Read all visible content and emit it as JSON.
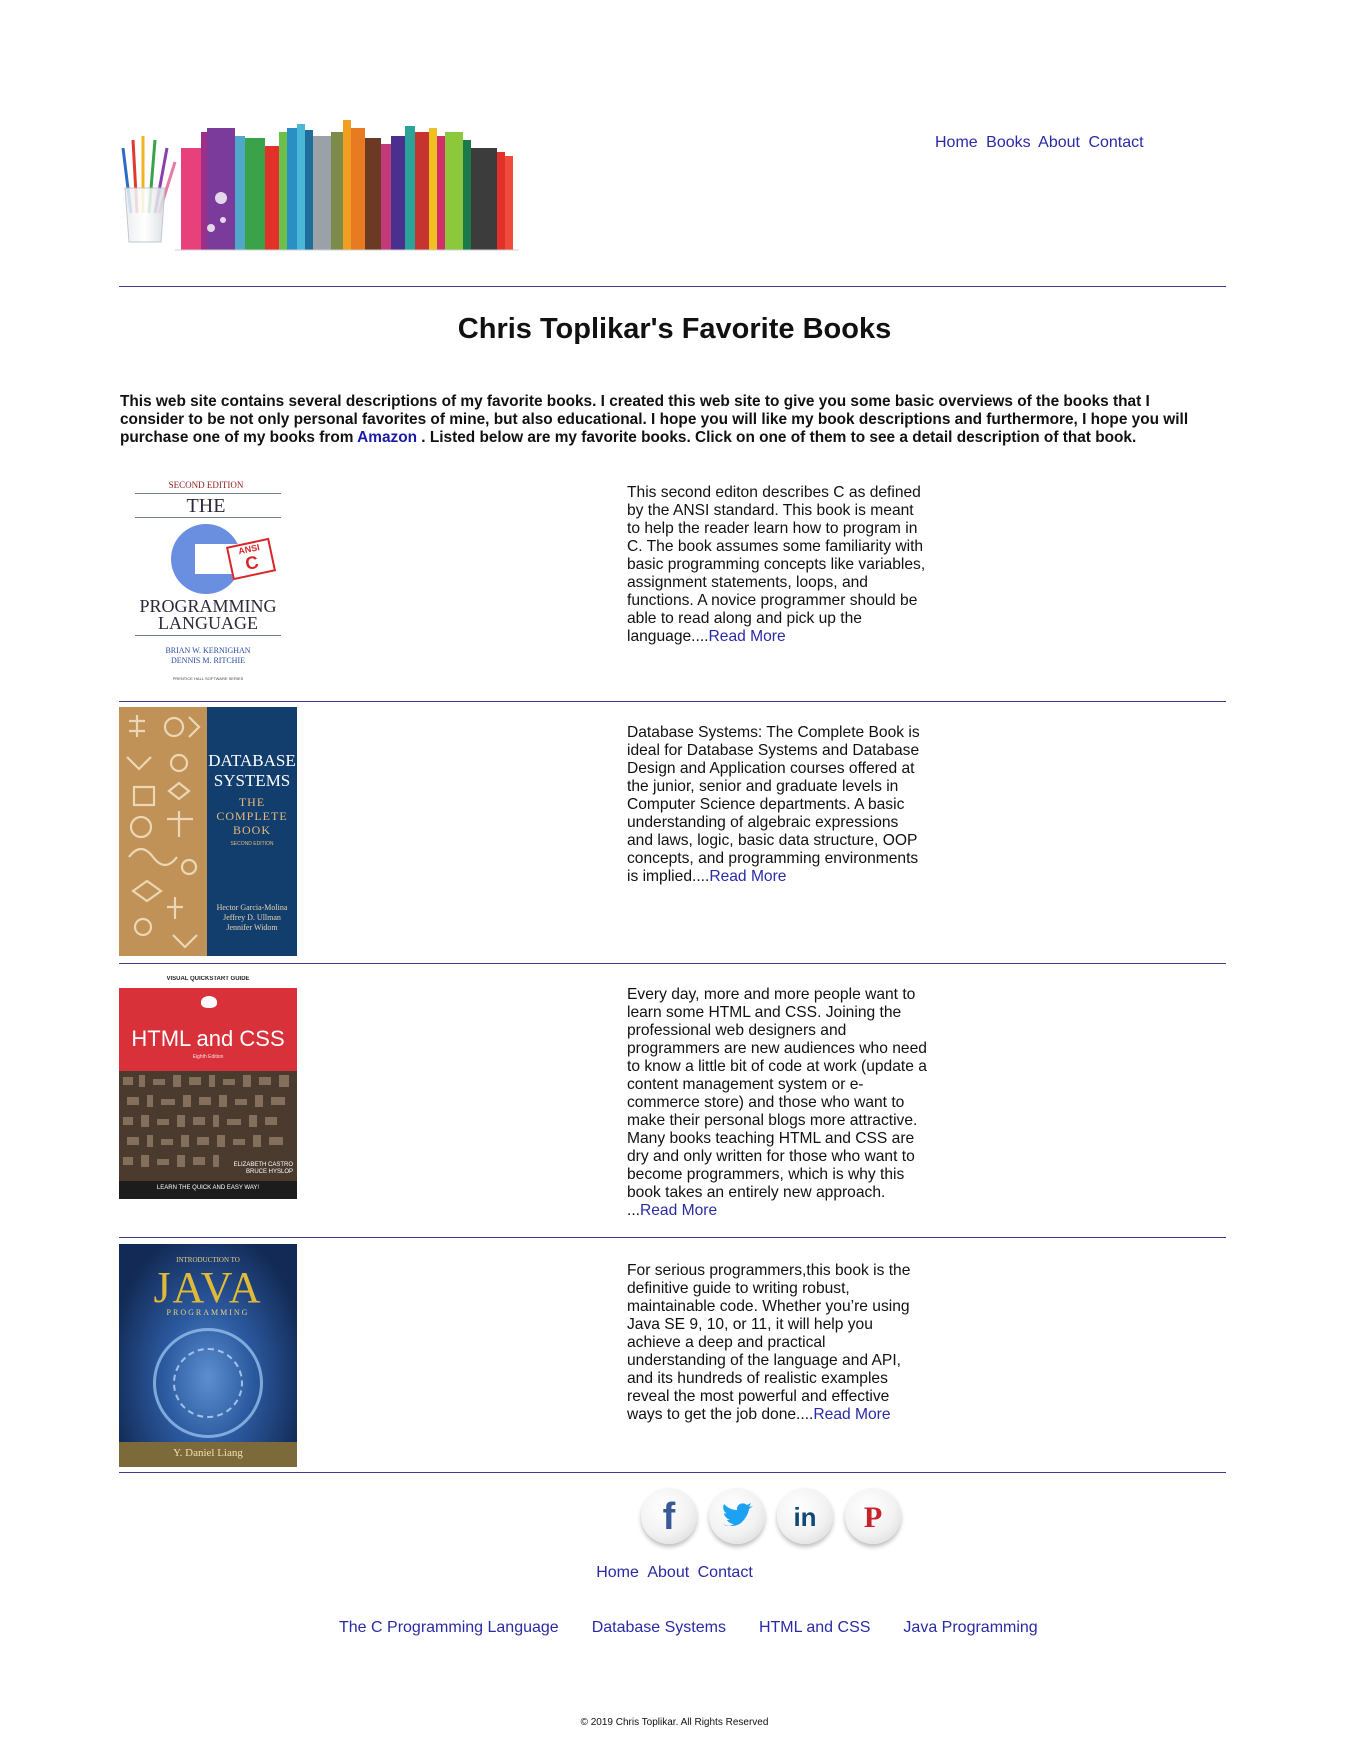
{
  "header": {
    "nav": [
      {
        "label": "Home"
      },
      {
        "label": "Books"
      },
      {
        "label": "About"
      },
      {
        "label": "Contact"
      }
    ]
  },
  "main": {
    "title": "Chris Toplikar's Favorite Books",
    "intro_before": "This web site contains several descriptions of my favorite books. I created this web site to give you some basic overviews of the books that I consider to be not only personal favorites of mine, but also educational. I hope you will like my book descriptions and furthermore, I hope you will purchase one of my books from ",
    "intro_link": "Amazon",
    "intro_after": " . Listed below are my favorite books. Click on one of them to see a detail description of that book.",
    "books": [
      {
        "cover": {
          "edition": "SECOND EDITION",
          "the": "THE",
          "badge_top": "ANSI",
          "badge_letter": "C",
          "line1": "PROGRAMMING",
          "line2": "LANGUAGE",
          "author1": "BRIAN W. KERNIGHAN",
          "author2": "DENNIS M. RITCHIE",
          "series": "PRENTICE HALL SOFTWARE SERIES"
        },
        "text": "This second editon describes C as defined by the ANSI standard. This book is meant to help the reader learn how to program in C. The book assumes some familiarity with basic programming concepts like variables, assignment statements, loops, and functions. A novice programmer should be able to read along and pick up the language....",
        "link": "Read More"
      },
      {
        "cover": {
          "title1": "DATABASE",
          "title2": "SYSTEMS",
          "sub1": "THE",
          "sub2": "COMPLETE",
          "sub3": "BOOK",
          "edition": "SECOND EDITION",
          "author1": "Hector Garcia-Molina",
          "author2": "Jeffrey D. Ullman",
          "author3": "Jennifer Widom"
        },
        "text": "Database Systems: The Complete Book is ideal for Database Systems and Database Design and Application courses offered at the junior, senior and graduate levels in Computer Science departments. A basic understanding of algebraic expressions and laws, logic, basic data structure, OOP concepts, and programming environments is implied....",
        "link": "Read More"
      },
      {
        "cover": {
          "top": "VISUAL QUICKSTART GUIDE",
          "title": "HTML and CSS",
          "edition": "Eighth Edition",
          "author1": "ELIZABETH CASTRO",
          "author2": "BRUCE HYSLOP",
          "tagline": "LEARN THE QUICK AND EASY WAY!"
        },
        "text": "Every day, more and more people want to learn some HTML and CSS. Joining the professional web designers and programmers are new audiences who need to know a little bit of code at work (update a content management system or e-commerce store) and those who want to make their personal blogs more attractive. Many books teaching HTML and CSS are dry and only written for those who want to become programmers, which is why this book takes an entirely new approach. ...",
        "link": "Read More"
      },
      {
        "cover": {
          "top": "INTRODUCTION TO",
          "title": "JAVA",
          "sub": "PROGRAMMING",
          "author": "Y. Daniel Liang"
        },
        "text": "For serious programmers,this book is the definitive guide to writing robust, maintainable code. Whether you’re using Java SE 9, 10, or 11, it will help you achieve a deep and practical understanding of the language and API, and its hundreds of realistic examples reveal the most powerful and effective ways to get the job done....",
        "link": "Read More"
      }
    ]
  },
  "footer": {
    "social": [
      {
        "name": "facebook",
        "glyph": "f",
        "color": "#3b5998"
      },
      {
        "name": "twitter",
        "color": "#1da1f2"
      },
      {
        "name": "linkedin",
        "glyph": "in",
        "color": "#0e4a78"
      },
      {
        "name": "pinterest",
        "glyph": "P",
        "color": "#c8232c"
      }
    ],
    "nav": [
      {
        "label": "Home"
      },
      {
        "label": "About"
      },
      {
        "label": "Contact"
      }
    ],
    "book_links": [
      {
        "label": "The C Programming Language"
      },
      {
        "label": "Database Systems"
      },
      {
        "label": "HTML and CSS"
      },
      {
        "label": "Java Programming"
      }
    ],
    "copyright": "© 2019 Chris Toplikar. All Rights Reserved"
  },
  "colors": {
    "link": "#2a2aa5",
    "rule": "#3b3b8f",
    "text": "#111111"
  }
}
